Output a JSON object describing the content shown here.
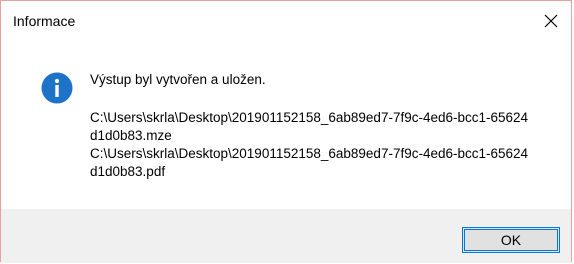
{
  "window": {
    "title": "Informace",
    "close_icon": "close-icon"
  },
  "message": {
    "icon": "info-icon",
    "icon_color": "#1e73c8",
    "text": "Výstup byl vytvořen a uložen.",
    "lines": [
      "C:\\Users\\skrla\\Desktop\\201901152158_6ab89ed7-7f9c-4ed6-bcc1-65624",
      "d1d0b83.mze",
      "C:\\Users\\skrla\\Desktop\\201901152158_6ab89ed7-7f9c-4ed6-bcc1-65624",
      "d1d0b83.pdf"
    ]
  },
  "buttons": {
    "ok_label": "OK"
  },
  "colors": {
    "accent": "#0078d7",
    "footer_bg": "#f0f0f0",
    "border": "#e8a0a0"
  }
}
